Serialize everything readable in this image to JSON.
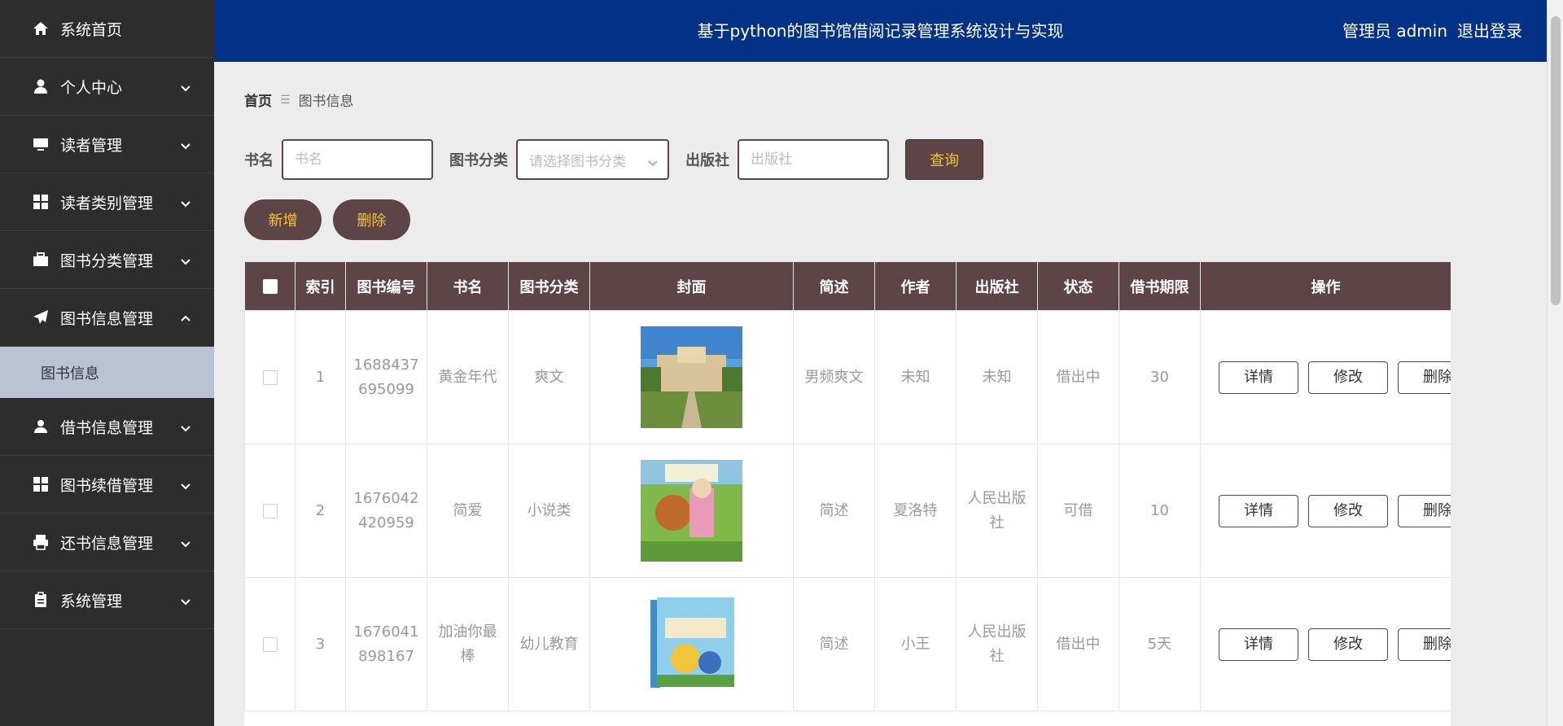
{
  "sidebar": {
    "items": [
      {
        "label": "系统首页",
        "icon": "home-icon"
      },
      {
        "label": "个人中心",
        "icon": "user-icon"
      },
      {
        "label": "读者管理",
        "icon": "monitor-icon"
      },
      {
        "label": "读者类别管理",
        "icon": "grid-icon"
      },
      {
        "label": "图书分类管理",
        "icon": "briefcase-icon"
      },
      {
        "label": "图书信息管理",
        "icon": "paper-plane-icon"
      },
      {
        "label": "借书信息管理",
        "icon": "user-tie-icon"
      },
      {
        "label": "图书续借管理",
        "icon": "grid-icon"
      },
      {
        "label": "还书信息管理",
        "icon": "printer-icon"
      },
      {
        "label": "系统管理",
        "icon": "clipboard-icon"
      }
    ],
    "sub_item": "图书信息"
  },
  "header": {
    "title": "基于python的图书馆借阅记录管理系统设计与实现",
    "role": "管理员 admin",
    "logout": "退出登录"
  },
  "breadcrumb": {
    "home": "首页",
    "separator": "☰",
    "current": "图书信息"
  },
  "search": {
    "name_label": "书名",
    "name_placeholder": "书名",
    "category_label": "图书分类",
    "category_placeholder": "请选择图书分类",
    "publisher_label": "出版社",
    "publisher_placeholder": "出版社",
    "query_button": "查询"
  },
  "actions": {
    "add": "新增",
    "delete": "删除"
  },
  "table": {
    "headers": [
      "索引",
      "图书编号",
      "书名",
      "图书分类",
      "封面",
      "简述",
      "作者",
      "出版社",
      "状态",
      "借书期限",
      "操作"
    ],
    "rows": [
      {
        "index": "1",
        "code": "1688437695099",
        "name": "黄金年代",
        "category": "爽文",
        "desc": "男频爽文",
        "author": "未知",
        "publisher": "未知",
        "status": "借出中",
        "period": "30"
      },
      {
        "index": "2",
        "code": "1676042420959",
        "name": "简爱",
        "category": "小说类",
        "desc": "简述",
        "author": "夏洛特",
        "publisher": "人民出版社",
        "status": "可借",
        "period": "10"
      },
      {
        "index": "3",
        "code": "1676041898167",
        "name": "加油你最棒",
        "category": "幼儿教育",
        "desc": "简述",
        "author": "小王",
        "publisher": "人民出版社",
        "status": "借出中",
        "period": "5天"
      }
    ],
    "op_detail": "详情",
    "op_edit": "修改",
    "op_delete": "删除"
  },
  "colors": {
    "header_bg": "#023186",
    "sidebar_bg": "#2d2d2d",
    "accent": "#5c4447",
    "accent_text": "#f5c43c",
    "sub_active": "#b9c3d4"
  }
}
